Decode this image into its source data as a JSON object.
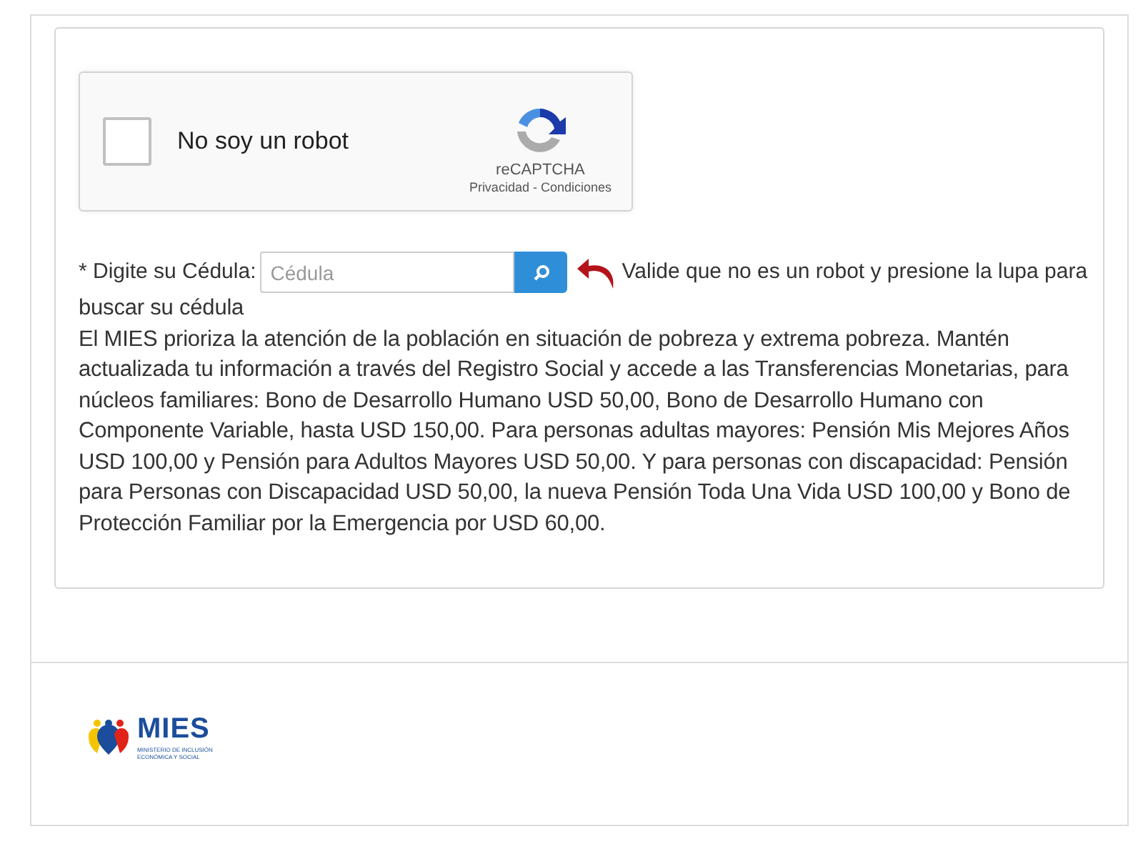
{
  "captcha": {
    "checked": false,
    "label": "No soy un robot",
    "brand": "reCAPTCHA",
    "links": "Privacidad - Condiciones"
  },
  "search": {
    "required_mark": "*",
    "label": "Digite su Cédula:",
    "placeholder": "Cédula",
    "hint": "Valide que no es un robot y presione la lupa para",
    "hint_continued": "buscar su cédula"
  },
  "info": "El MIES prioriza la atención de la población en situación de pobreza y extrema pobreza. Mantén actualizada tu información a través del Registro Social y accede a las Transferencias Monetarias, para núcleos familiares: Bono de Desarrollo Humano USD 50,00, Bono de Desarrollo Humano con Componente Variable, hasta USD 150,00. Para personas adultas mayores: Pensión Mis Mejores Años USD 100,00 y Pensión para Adultos Mayores USD 50,00. Y para personas con discapacidad: Pensión para Personas con Discapacidad USD 50,00, la nueva Pensión Toda Una Vida USD 100,00 y Bono de Protección Familiar por la Emergencia por USD 60,00.",
  "footer": {
    "logo_name": "MIES",
    "logo_subtitle": "MINISTERIO DE INCLUSIÓN ECONÓMICA Y SOCIAL"
  }
}
